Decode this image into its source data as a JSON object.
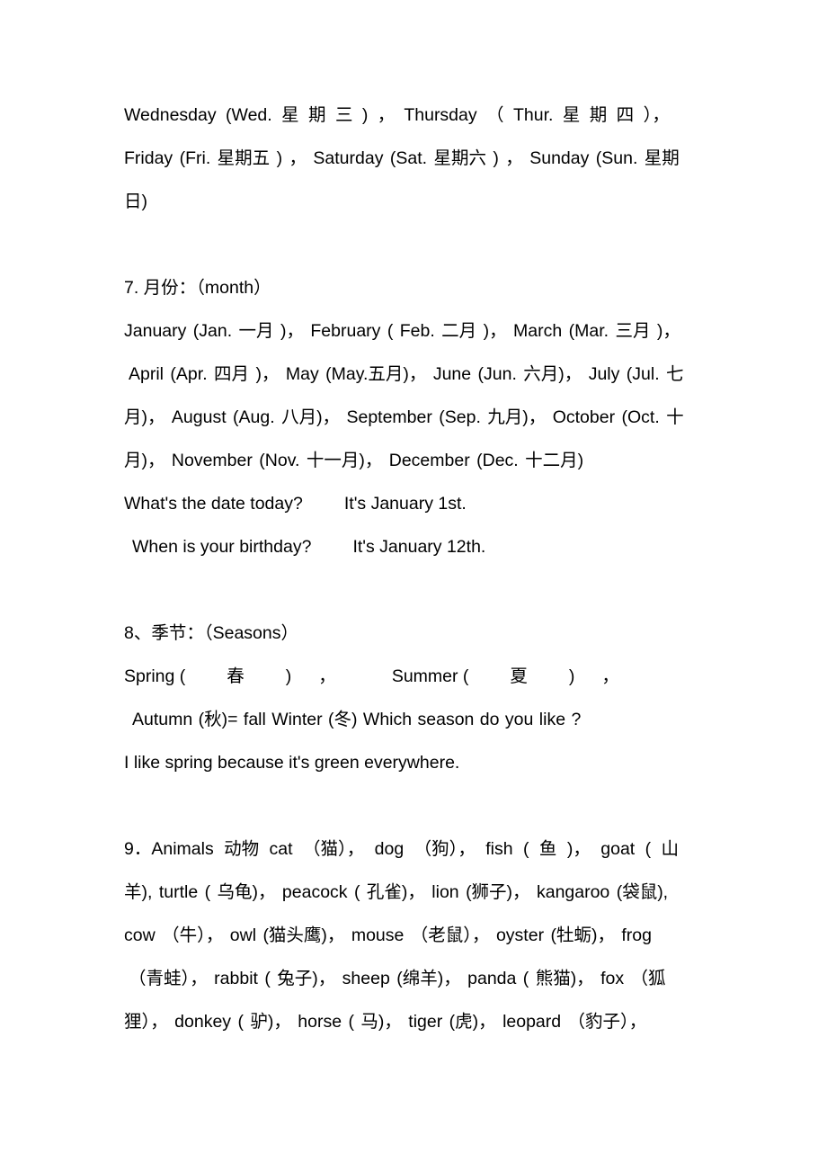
{
  "document": {
    "background_color": "#ffffff",
    "text_color": "#000000",
    "sections": {
      "weekdays_continued": {
        "lines": [
          "Wednesday (Wed. 星 期 三 ) ，  Thursday  （ Thur. 星 期 四 ），",
          "Friday (Fri. 星期五 ) ，  Saturday (Sat. 星期六 ) ，  Sunday (Sun. 星期",
          "日)"
        ]
      },
      "months": {
        "heading": "7. 月份：（month）",
        "lines": [
          "January (Jan. 一月 )， February ( Feb. 二月 )， March (Mar. 三月 )，",
          "April (Apr. 四月 )， May (May.五月)， June (Jun. 六月)， July (Jul. 七",
          "月)， August (Aug. 八月)， September (Sep. 九月)， October (Oct. 十",
          "月)， November (Nov. 十一月)， December (Dec. 十二月)"
        ],
        "dialogue": [
          {
            "question": "What's the date today?",
            "answer": "It's January 1st."
          },
          {
            "question": "When is your birthday?",
            "answer": "It's January 12th."
          }
        ]
      },
      "seasons": {
        "heading": "8、季节：（Seasons）",
        "spring_label": "Spring (",
        "spring_zh": "春",
        "spring_close": ")",
        "comma_1": "，",
        "summer_label": "Summer (",
        "summer_zh": "夏",
        "summer_close": ")",
        "comma_2": "，",
        "autumn_line": "Autumn (秋)= fall    Winter (冬) Which season do you like ?",
        "example_sentence": "I like spring because it's green everywhere."
      },
      "animals": {
        "lines": [
          "9．Animals 动物 cat （猫）， dog （狗）， fish ( 鱼 )， goat ( 山",
          "羊), turtle ( 乌龟)， peacock ( 孔雀)， lion (狮子)， kangaroo (袋鼠),",
          "cow （牛）， owl (猫头鹰)， mouse （老鼠）， oyster (牡蛎)， frog",
          "（青蛙）， rabbit ( 兔子)， sheep (绵羊)， panda ( 熊猫)， fox （狐",
          "狸）， donkey ( 驴)， horse ( 马)， tiger (虎)， leopard （豹子），"
        ]
      }
    }
  }
}
